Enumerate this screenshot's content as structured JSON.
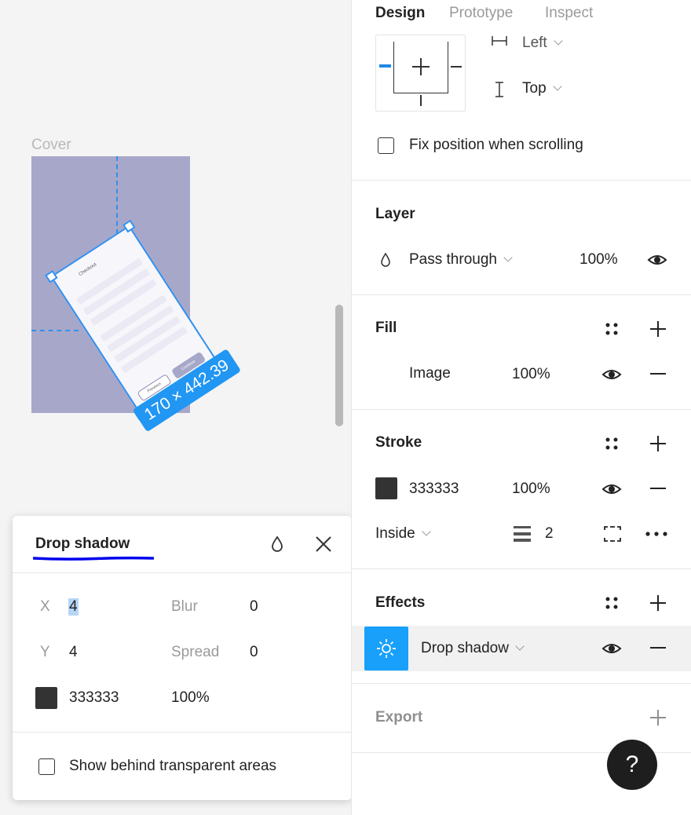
{
  "canvas": {
    "frame_label": "Cover",
    "selection_size": "170 × 442.39",
    "phone_title": "Checkout",
    "phone_left_button": "Previous",
    "phone_right_button": "Continue"
  },
  "popover": {
    "title": "Drop shadow",
    "x_label": "X",
    "x_value": "4",
    "y_label": "Y",
    "y_value": "4",
    "blur_label": "Blur",
    "blur_value": "0",
    "spread_label": "Spread",
    "spread_value": "0",
    "color_hex": "333333",
    "color_opacity": "100%",
    "show_behind_label": "Show behind transparent areas",
    "icons": [
      "drop-icon",
      "close-icon"
    ]
  },
  "tabs": [
    {
      "label": "Design",
      "active": true
    },
    {
      "label": "Prototype",
      "active": false
    },
    {
      "label": "Inspect",
      "active": false
    }
  ],
  "constraints": {
    "horizontal": "Left",
    "vertical": "Top",
    "fix_position_label": "Fix position when scrolling"
  },
  "layer": {
    "title": "Layer",
    "blend_mode": "Pass through",
    "opacity": "100%"
  },
  "fill": {
    "title": "Fill",
    "type": "Image",
    "opacity": "100%"
  },
  "stroke": {
    "title": "Stroke",
    "color_hex": "333333",
    "opacity": "100%",
    "position": "Inside",
    "weight": "2"
  },
  "effects": {
    "title": "Effects",
    "effect_name": "Drop shadow"
  },
  "export": {
    "title": "Export"
  },
  "help": {
    "label": "?"
  },
  "colors": {
    "accent": "#18a0fb",
    "selection": "#2f8ff0",
    "frame_fill": "#a7a7c9",
    "swatch": "#333333",
    "annotation_underline": "#0000ee"
  }
}
